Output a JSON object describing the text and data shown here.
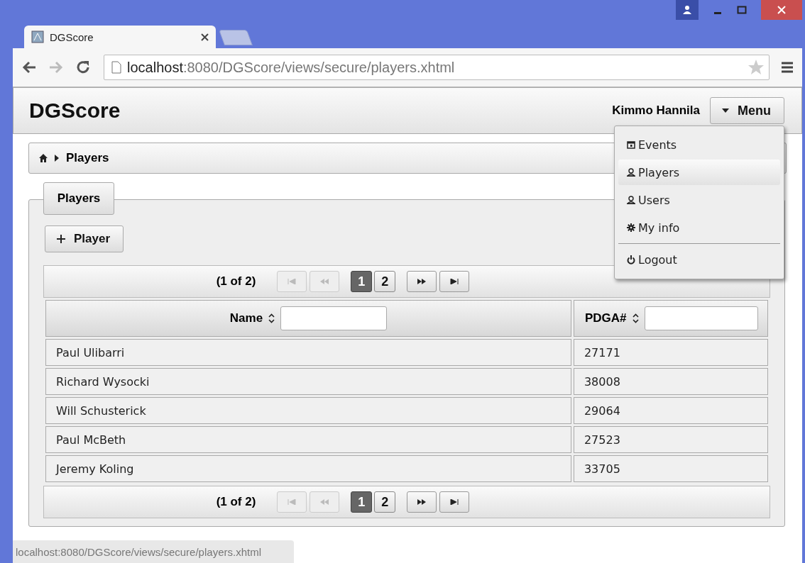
{
  "browser": {
    "tab_title": "DGScore",
    "url_host": "localhost",
    "url_rest": ":8080/DGScore/views/secure/players.xhtml",
    "status_url": "localhost:8080/DGScore/views/secure/players.xhtml"
  },
  "header": {
    "brand": "DGScore",
    "user": "Kimmo Hannila",
    "menu_button": "Menu"
  },
  "breadcrumb": [
    "Players"
  ],
  "panel": {
    "tab": "Players",
    "add_button": "Player",
    "paginators": [
      {
        "report": "(1 of 2)",
        "pages": [
          {
            "label": "1",
            "selected": true
          },
          {
            "label": "2",
            "selected": false
          }
        ],
        "nav": [
          {
            "kind": "first",
            "disabled": true
          },
          {
            "kind": "prev",
            "disabled": true
          },
          {
            "kind": "next",
            "disabled": false
          },
          {
            "kind": "last",
            "disabled": false
          }
        ]
      },
      {
        "report": "(1 of 2)",
        "pages": [
          {
            "label": "1",
            "selected": true
          },
          {
            "label": "2",
            "selected": false
          }
        ],
        "nav": [
          {
            "kind": "first",
            "disabled": true
          },
          {
            "kind": "prev",
            "disabled": true
          },
          {
            "kind": "next",
            "disabled": false
          },
          {
            "kind": "last",
            "disabled": false
          }
        ]
      }
    ],
    "columns": [
      {
        "label": "Name"
      },
      {
        "label": "PDGA#"
      }
    ],
    "rows": [
      [
        "Paul Ulibarri",
        "27171"
      ],
      [
        "Richard Wysocki",
        "38008"
      ],
      [
        "Will Schusterick",
        "29064"
      ],
      [
        "Paul McBeth",
        "27523"
      ],
      [
        "Jeremy Koling",
        "33705"
      ]
    ]
  },
  "menu": {
    "groups": [
      [
        {
          "label": "Events",
          "kind": "calendar",
          "selected": false
        },
        {
          "label": "Players",
          "kind": "person",
          "selected": true
        },
        {
          "label": "Users",
          "kind": "person",
          "selected": false
        },
        {
          "label": "My info",
          "kind": "gear",
          "selected": false
        }
      ],
      [
        {
          "label": "Logout",
          "kind": "power",
          "selected": false
        }
      ]
    ]
  }
}
